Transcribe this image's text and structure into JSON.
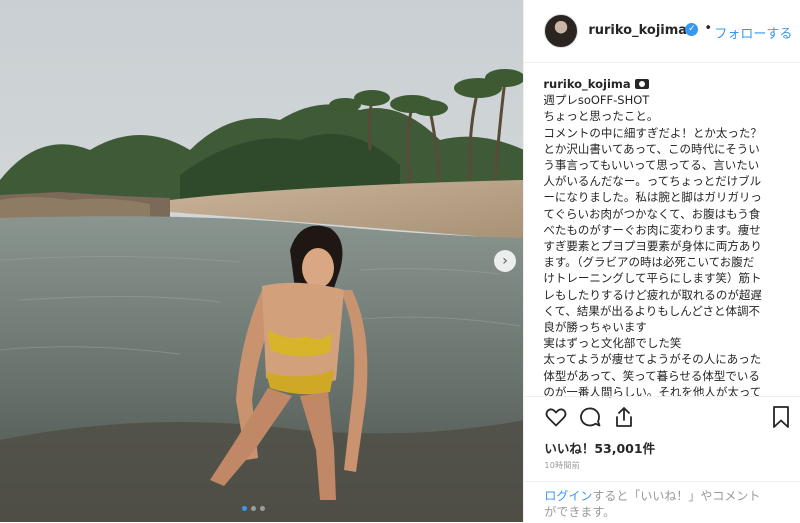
{
  "header": {
    "username": "ruriko_kojima",
    "separator": "•",
    "follow_label": "フォローする",
    "verified_icon": "verified-badge-icon"
  },
  "caption": {
    "username": "ruriko_kojima",
    "lines": [
      "週プレsoOFF-SHOT",
      "ちょっと思ったこと。",
      "コメントの中に細すぎだよ！とか太った？",
      "とか沢山書いてあって、この時代にそうい",
      "う事言ってもいいって思ってる、言いたい",
      "人がいるんだなー。ってちょっとだけブル",
      "ーになりました。私は腕と脚はガリガリっ",
      "てぐらいお肉がつかなくて、お腹はもう食",
      "べたものがすーぐお肉に変わります。痩せ",
      "すぎ要素とプヨプヨ要素が身体に両方あり",
      "ます。（グラビアの時は必死こいてお腹だ",
      "けトレーニングして平らにします笑）筋ト",
      "レもしたりするけど疲れが取れるのが超遅",
      "くて、結果が出るよりもしんどさと体調不",
      "良が勝っちゃいます",
      "実はずっと文化部でした笑",
      "太ってようが痩せてようがその人にあった",
      "体型があって、笑って暮らせる体型でいる",
      "のが一番人間らしい。それを他人が太って"
    ]
  },
  "actions": {
    "like_icon": "heart-icon",
    "comment_icon": "comment-icon",
    "share_icon": "share-icon",
    "save_icon": "bookmark-icon",
    "likes_text": "いいね！53,001件",
    "time_text": "10時間前"
  },
  "login": {
    "link_label": "ログイン",
    "rest_text": "すると「いいね！」やコメント",
    "line2": "ができます。"
  },
  "carousel": {
    "next_icon": "chevron-right-icon",
    "slides_total": 3,
    "slides_active": 1
  },
  "colors": {
    "accent": "#3897f0",
    "text": "#262626",
    "muted": "#999999"
  }
}
